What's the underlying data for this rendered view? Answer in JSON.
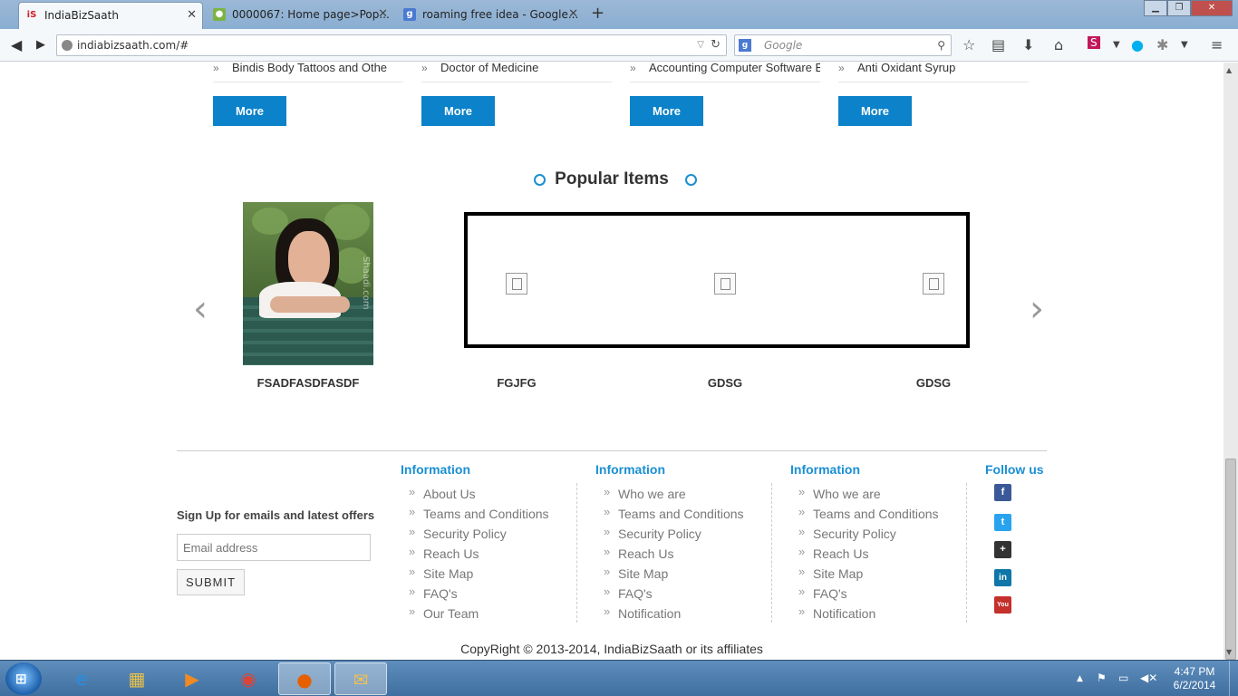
{
  "browser": {
    "tabs": [
      {
        "label": "IndiaBizSaath",
        "favicon": "iS"
      },
      {
        "label": "0000067: Home page>Pop...",
        "favicon": "bug"
      },
      {
        "label": "roaming free idea - Google...",
        "favicon": "g"
      }
    ],
    "url": "indiabizsaath.com/#",
    "search_placeholder": "Google"
  },
  "categories": {
    "columns": [
      {
        "last_link": "Bindis Body Tattoos and Othe",
        "more_label": "More"
      },
      {
        "last_link": "Doctor of Medicine",
        "more_label": "More"
      },
      {
        "last_link": "Accounting Computer Software E",
        "more_label": "More"
      },
      {
        "last_link": "Anti Oxidant Syrup",
        "more_label": "More"
      }
    ]
  },
  "popular": {
    "title": "Popular Items",
    "items": [
      {
        "label": "FSADFASDFASDF"
      },
      {
        "label": "FGJFG"
      },
      {
        "label": "GDSG"
      },
      {
        "label": "GDSG"
      }
    ],
    "prev_arrow": "‹",
    "next_arrow": "›"
  },
  "signup": {
    "title": "Sign Up for emails and latest offers",
    "email_placeholder": "Email address",
    "submit_label": "SUBMIT"
  },
  "footer": {
    "columns": [
      {
        "heading": "Information",
        "links": [
          "About Us",
          "Teams and Conditions",
          "Security Policy",
          "Reach Us",
          "Site Map",
          "FAQ's",
          "Our Team"
        ]
      },
      {
        "heading": "Information",
        "links": [
          "Who we are",
          "Teams and Conditions",
          "Security Policy",
          "Reach Us",
          "Site Map",
          "FAQ's",
          "Notification"
        ]
      },
      {
        "heading": "Information",
        "links": [
          "Who we are",
          "Teams and Conditions",
          "Security Policy",
          "Reach Us",
          "Site Map",
          "FAQ's",
          "Notification"
        ]
      }
    ],
    "follow_heading": "Follow us",
    "social": [
      {
        "name": "facebook-icon",
        "glyph": "f",
        "color": "#3b5998"
      },
      {
        "name": "twitter-icon",
        "glyph": "t",
        "color": "#2aa3ef"
      },
      {
        "name": "google-plus-icon",
        "glyph": "+",
        "color": "#333333"
      },
      {
        "name": "linkedin-icon",
        "glyph": "in",
        "color": "#0e76a8"
      },
      {
        "name": "youtube-icon",
        "glyph": "You",
        "color": "#c4302b"
      }
    ],
    "copyright": "CopyRight © 2013-2014, IndiaBizSaath or its affiliates"
  },
  "taskbar": {
    "time": "4:47 PM",
    "date": "6/2/2014"
  },
  "colors": {
    "accent": "#0b82c9",
    "heading_blue": "#1a8fd3"
  }
}
